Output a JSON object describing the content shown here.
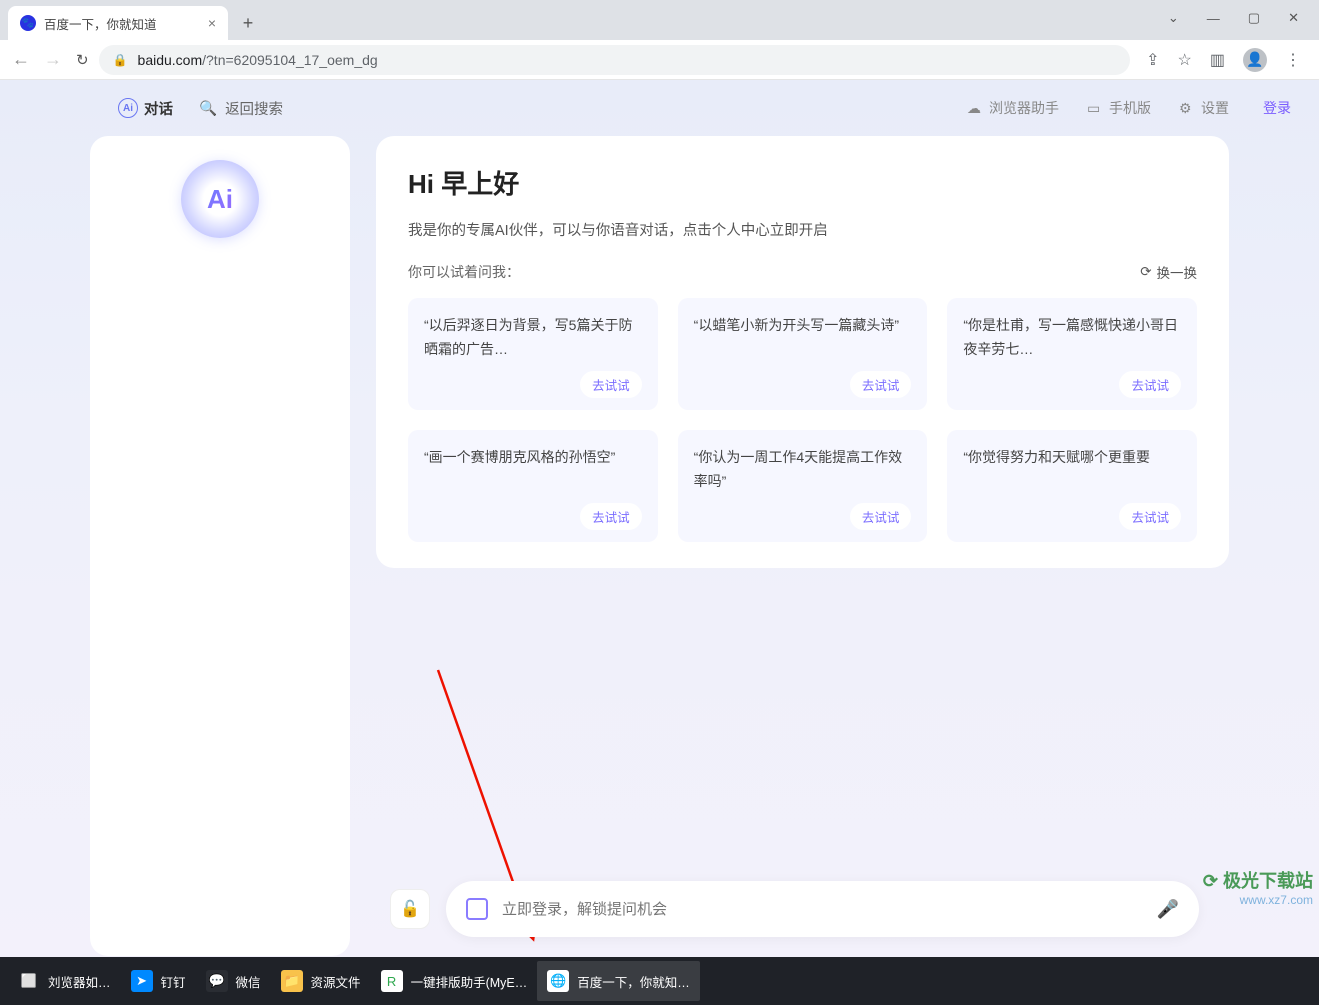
{
  "window": {
    "tab_title": "百度一下，你就知道"
  },
  "addr": {
    "url_host": "baidu.com",
    "url_path": "/?tn=62095104_17_oem_dg"
  },
  "topnav": {
    "chat": "对话",
    "back": "返回搜索",
    "assist": "浏览器助手",
    "mobile": "手机版",
    "settings": "设置",
    "login": "登录"
  },
  "sidebar": {
    "logo": "Ai"
  },
  "greeting": {
    "title": "Hi 早上好",
    "intro": "我是你的专属AI伙伴，可以与你语音对话，点击个人中心立即开启",
    "try_label": "你可以试着问我：",
    "swap": "换一换",
    "btn": "去试试"
  },
  "suggestions": [
    "“以后羿逐日为背景，写5篇关于防晒霜的广告…",
    "“以蜡笔小新为开头写一篇藏头诗”",
    "“你是杜甫，写一篇感慨快递小哥日夜辛劳七…",
    "“画一个赛博朋克风格的孙悟空”",
    "“你认为一周工作4天能提高工作效率吗”",
    "“你觉得努力和天赋哪个更重要"
  ],
  "input": {
    "placeholder": "立即登录，解锁提问机会"
  },
  "taskbar": {
    "items": [
      {
        "label": "刘览器如…",
        "color": "#2a2d33"
      },
      {
        "label": "钉钉",
        "color": "#0089ff"
      },
      {
        "label": "微信",
        "color": "#07c160"
      },
      {
        "label": "资源文件",
        "color": "#f8c24b"
      },
      {
        "label": "一键排版助手(MyE…",
        "color": "#2fa84f"
      },
      {
        "label": "百度一下，你就知…",
        "color": "#fff"
      }
    ]
  },
  "watermark": {
    "site": "极光下载站",
    "url": "www.xz7.com"
  }
}
